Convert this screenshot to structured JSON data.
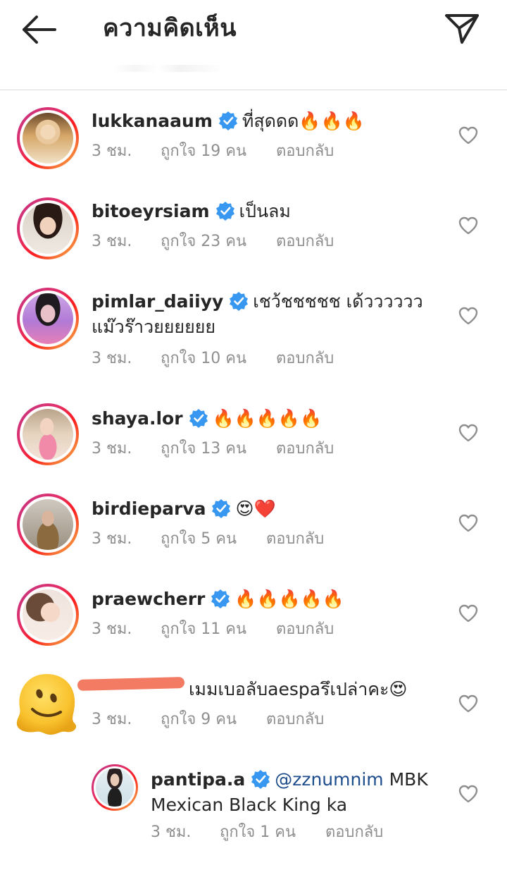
{
  "header": {
    "title": "ความคิดเห็น"
  },
  "comments": [
    {
      "username": "lukkanaaum",
      "text": "ที่สุดดด",
      "emoji": "🔥🔥🔥",
      "time": "3 ชม.",
      "likes": "ถูกใจ 19 คน",
      "reply": "ตอบกลับ"
    },
    {
      "username": "bitoeyrsiam",
      "text": "เป็นลม",
      "emoji": "",
      "time": "3 ชม.",
      "likes": "ถูกใจ 23 คน",
      "reply": "ตอบกลับ"
    },
    {
      "username": "pimlar_daiiyy",
      "text": "เชว้ชชชชช เด้วววววว แม๊วร๊าวยยยยยย",
      "emoji": "",
      "time": "3 ชม.",
      "likes": "ถูกใจ 10 คน",
      "reply": "ตอบกลับ"
    },
    {
      "username": "shaya.lor",
      "text": "",
      "emoji": "🔥🔥🔥🔥🔥",
      "time": "3 ชม.",
      "likes": "ถูกใจ 13 คน",
      "reply": "ตอบกลับ"
    },
    {
      "username": "birdieparva",
      "text": "",
      "emoji": "😍❤️",
      "time": "3 ชม.",
      "likes": "ถูกใจ 5 คน",
      "reply": "ตอบกลับ"
    },
    {
      "username": "praewcherr",
      "text": "",
      "emoji": "🔥🔥🔥🔥🔥",
      "time": "3 ชม.",
      "likes": "ถูกใจ 11 คน",
      "reply": "ตอบกลับ"
    },
    {
      "username": "",
      "text": "เมมเบอลับaespaรึเปล่าคะ",
      "emoji": "😍",
      "time": "3 ชม.",
      "likes": "ถูกใจ 9 คน",
      "reply": "ตอบกลับ"
    }
  ],
  "reply_comment": {
    "username": "pantipa.a",
    "mention": "@zznumnim",
    "text": " MBK Mexican Black King ka",
    "time": "3 ชม.",
    "likes": "ถูกใจ 1 คน",
    "reply": "ตอบกลับ"
  },
  "colors": {
    "verified": "#3897f0",
    "meta": "#8e8e8e",
    "mention": "#1e4d8c"
  },
  "icons": {
    "back": "arrow-left-icon",
    "send": "paper-plane-icon",
    "like": "heart-outline-icon",
    "verified": "verified-badge-icon"
  }
}
